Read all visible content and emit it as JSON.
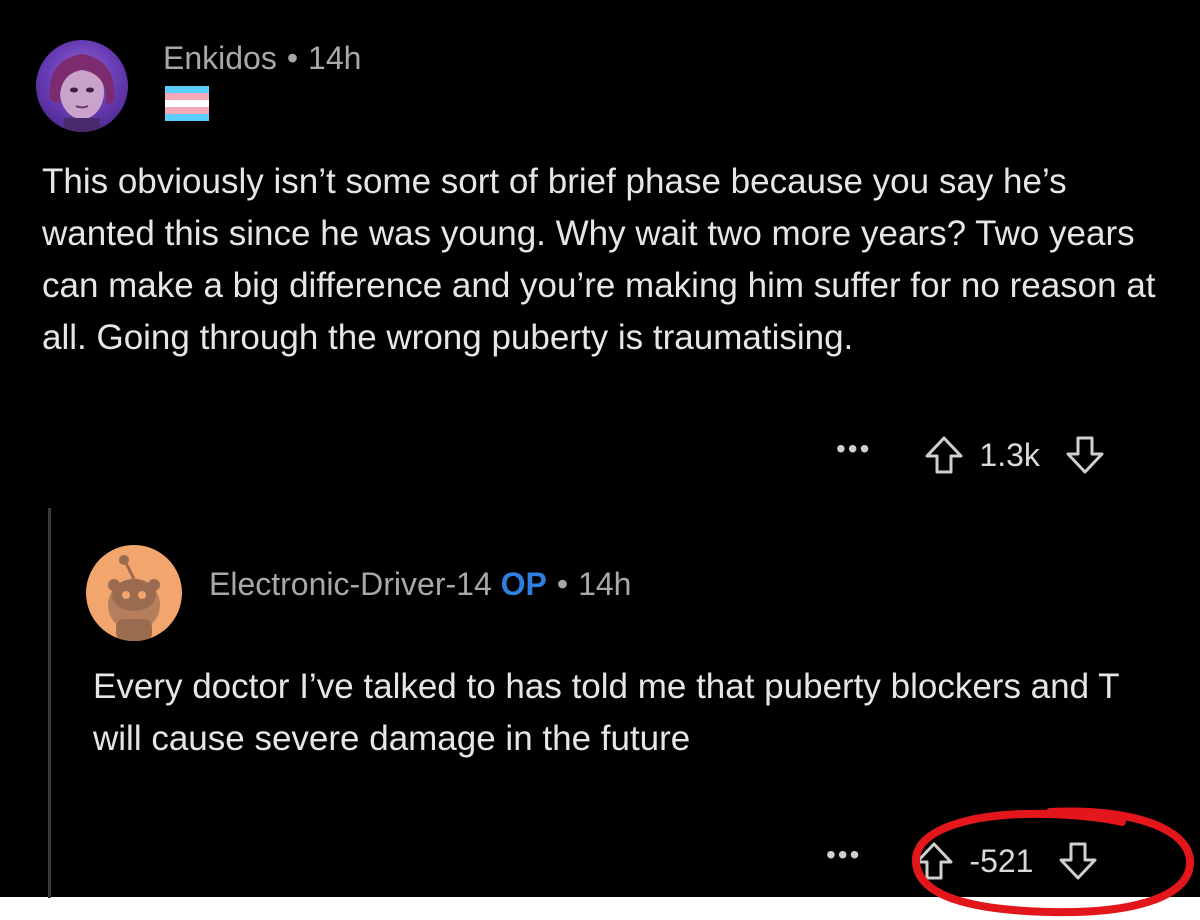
{
  "comment": {
    "author": "Enkidos",
    "separator": "•",
    "time": "14h",
    "flair_colors": [
      "#5BCEFA",
      "#F5A9B8",
      "#FFFFFF",
      "#F5A9B8",
      "#5BCEFA"
    ],
    "body": "This obviously isn’t some sort of brief phase because you say he’s wanted this since he was young. Why wait two more years? Two years can make a big difference and you’re making him suffer for no reason at all. Going through the wrong puberty is traumatising.",
    "more_label": "•••",
    "score": "1.3k",
    "upvote_icon": "arrow-up-outline-icon",
    "downvote_icon": "arrow-down-outline-icon"
  },
  "reply": {
    "author": "Electronic-Driver-14",
    "op_tag": "OP",
    "separator": "•",
    "time": "14h",
    "body": "Every doctor I’ve talked to has told me that puberty blockers and T will cause severe damage in the future",
    "more_label": "•••",
    "score": "-521",
    "upvote_icon": "arrow-up-outline-icon",
    "downvote_icon": "arrow-down-outline-icon"
  },
  "annotation": {
    "color": "#e3161b"
  }
}
